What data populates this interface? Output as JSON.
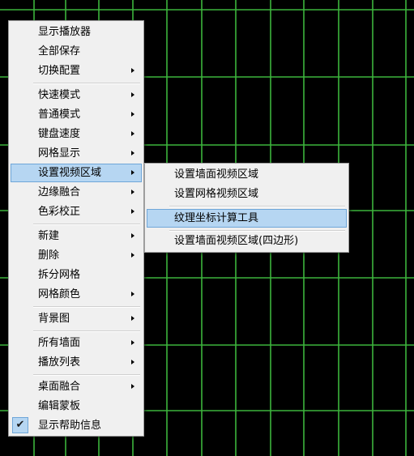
{
  "colors": {
    "background": "#000000",
    "grid_line": "#3cb43c",
    "menu_bg": "#f0f0f0",
    "highlight_bg": "#b6d6f2",
    "highlight_border": "#6fa6d8"
  },
  "context_menu": {
    "items": [
      {
        "label": "显示播放器"
      },
      {
        "label": "全部保存"
      },
      {
        "label": "切换配置"
      },
      {
        "label": "快速模式"
      },
      {
        "label": "普通模式"
      },
      {
        "label": "键盘速度"
      },
      {
        "label": "网格显示"
      },
      {
        "label": "设置视频区域"
      },
      {
        "label": "边缘融合"
      },
      {
        "label": "色彩校正"
      },
      {
        "label": "新建"
      },
      {
        "label": "删除"
      },
      {
        "label": "拆分网格"
      },
      {
        "label": "网格颜色"
      },
      {
        "label": "背景图"
      },
      {
        "label": "所有墙面"
      },
      {
        "label": "播放列表"
      },
      {
        "label": "桌面融合"
      },
      {
        "label": "编辑蒙板"
      },
      {
        "label": "显示帮助信息",
        "checked": true,
        "check_glyph": "✔"
      }
    ]
  },
  "submenu_video_area": {
    "items": [
      {
        "label": "设置墙面视频区域"
      },
      {
        "label": "设置网格视频区域"
      },
      {
        "label": "纹理坐标计算工具"
      },
      {
        "label": "设置墙面视频区域(四边形)"
      }
    ]
  }
}
